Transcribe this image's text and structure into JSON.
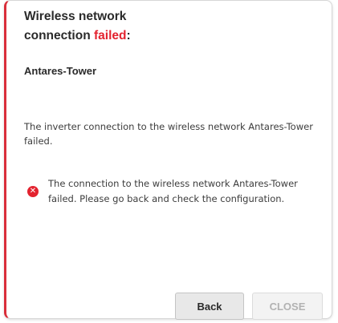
{
  "dialog": {
    "title_line1": "Wireless network",
    "title_line2_prefix": "connection ",
    "title_failed_word": "failed",
    "title_suffix": ":",
    "network_name": "Antares-Tower",
    "message": "The inverter connection to the wireless network Antares-Tower failed.",
    "error_icon": "error-circle-x-icon",
    "error_message": "The connection to the wireless network Antares-Tower failed. Please go back and check the configuration."
  },
  "buttons": {
    "back_label": "Back",
    "close_label": "CLOSE"
  },
  "colors": {
    "accent_red": "#e3232f",
    "border_left": "#d92e3a",
    "disabled_text": "#b2b2b2"
  }
}
